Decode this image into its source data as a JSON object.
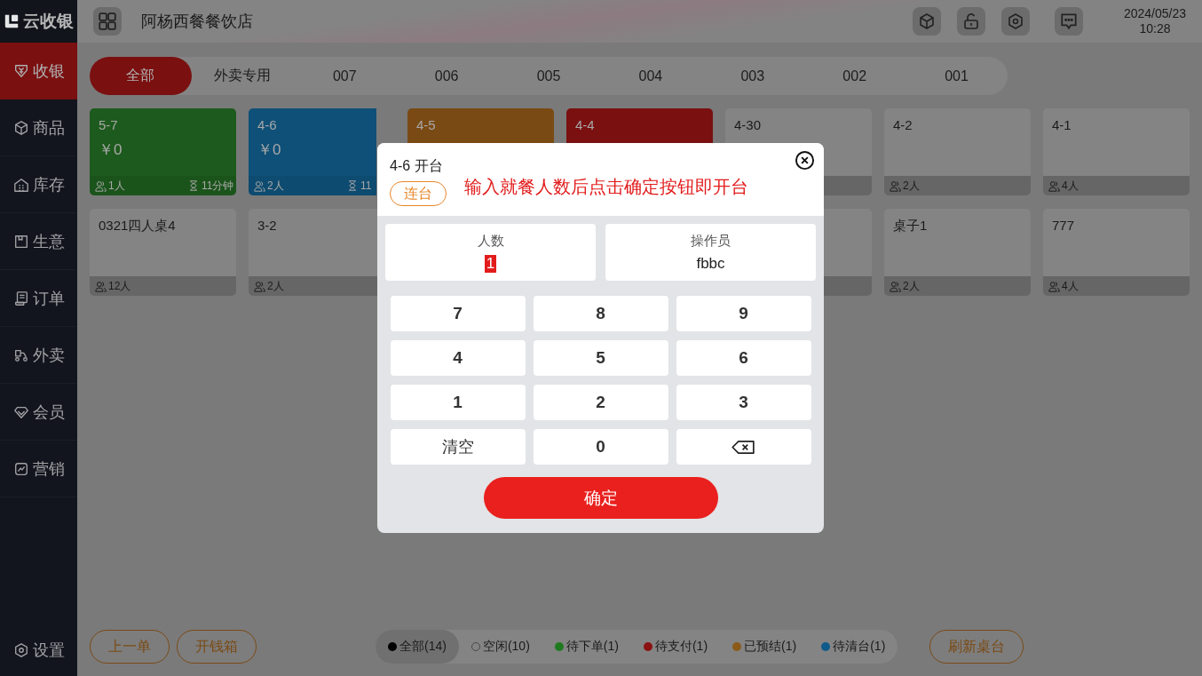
{
  "app": {
    "logo": "云收银"
  },
  "sidebar": {
    "items": [
      {
        "label": "收银",
        "selected": true
      },
      {
        "label": "商品",
        "selected": false
      },
      {
        "label": "库存",
        "selected": false
      },
      {
        "label": "生意",
        "selected": false
      },
      {
        "label": "订单",
        "selected": false
      },
      {
        "label": "外卖",
        "selected": false
      },
      {
        "label": "会员",
        "selected": false
      },
      {
        "label": "营销",
        "selected": false
      }
    ],
    "settings": "设置"
  },
  "header": {
    "store_name": "阿杨西餐餐饮店",
    "date": "2024/05/23",
    "time": "10:28"
  },
  "area_tabs": [
    {
      "label": "全部",
      "selected": true
    },
    {
      "label": "外卖专用",
      "selected": false
    },
    {
      "label": "007",
      "selected": false
    },
    {
      "label": "006",
      "selected": false
    },
    {
      "label": "005",
      "selected": false
    },
    {
      "label": "004",
      "selected": false
    },
    {
      "label": "003",
      "selected": false
    },
    {
      "label": "002",
      "selected": false
    },
    {
      "label": "001",
      "selected": false
    }
  ],
  "tables": [
    {
      "kind": "occupied",
      "color": "#1d5a1d",
      "title": "5-7",
      "amount": "￥0",
      "guests": "1人",
      "duration": "11分钟"
    },
    {
      "kind": "occupied",
      "color": "#0f5078",
      "title": "4-6",
      "amount": "￥0",
      "guests": "2人",
      "duration": "11"
    },
    {
      "kind": "occupied",
      "color": "#7a4a14",
      "title": "4-5"
    },
    {
      "kind": "occupied",
      "color": "#7a1010",
      "title": "4-4"
    },
    {
      "kind": "idle",
      "color": "#848484",
      "title": "4-30"
    },
    {
      "kind": "idle",
      "color": "#848484",
      "title": "4-2",
      "guests": "2人"
    },
    {
      "kind": "idle",
      "color": "#848484",
      "title": "4-1",
      "guests": "4人"
    },
    {
      "kind": "idle",
      "color": "#848484",
      "title": "0321四人桌4",
      "guests": "12人"
    },
    {
      "kind": "idle",
      "color": "#848484",
      "title": "3-2",
      "guests": "2人"
    },
    {
      "kind": "covered"
    },
    {
      "kind": "covered"
    },
    {
      "kind": "idle",
      "color": "#848484"
    },
    {
      "kind": "idle",
      "color": "#848484",
      "title": "桌子1",
      "guests": "2人"
    },
    {
      "kind": "idle",
      "color": "#848484",
      "title": "777",
      "guests": "4人"
    }
  ],
  "footer": {
    "buttons": [
      "上一单",
      "开钱箱"
    ],
    "refresh": "刷新桌台",
    "legend": [
      {
        "label": "全部(14)",
        "color": "#000000",
        "selected": true
      },
      {
        "label": "空闲(10)",
        "color": "#848484",
        "selected": false
      },
      {
        "label": "待下单(1)",
        "color": "#1f7a1f",
        "selected": false
      },
      {
        "label": "待支付(1)",
        "color": "#8a1212",
        "selected": false
      },
      {
        "label": "已预结(1)",
        "color": "#8a5a1a",
        "selected": false
      },
      {
        "label": "待清台(1)",
        "color": "#105a8a",
        "selected": false
      }
    ]
  },
  "dialog": {
    "title": "4-6 开台",
    "join_button": "连台",
    "hint": "输入就餐人数后点击确定按钮即开台",
    "fields": [
      {
        "label": "人数",
        "value": "1",
        "selected": true
      },
      {
        "label": "操作员",
        "value": "fbbc",
        "selected": false
      }
    ],
    "keys": [
      {
        "kind": "digit",
        "label": "7"
      },
      {
        "kind": "digit",
        "label": "8"
      },
      {
        "kind": "digit",
        "label": "9"
      },
      {
        "kind": "digit",
        "label": "4"
      },
      {
        "kind": "digit",
        "label": "5"
      },
      {
        "kind": "digit",
        "label": "6"
      },
      {
        "kind": "digit",
        "label": "1"
      },
      {
        "kind": "digit",
        "label": "2"
      },
      {
        "kind": "digit",
        "label": "3"
      },
      {
        "kind": "clear",
        "label": "清空"
      },
      {
        "kind": "digit",
        "label": "0"
      },
      {
        "kind": "backspace"
      }
    ],
    "confirm": "确定"
  }
}
